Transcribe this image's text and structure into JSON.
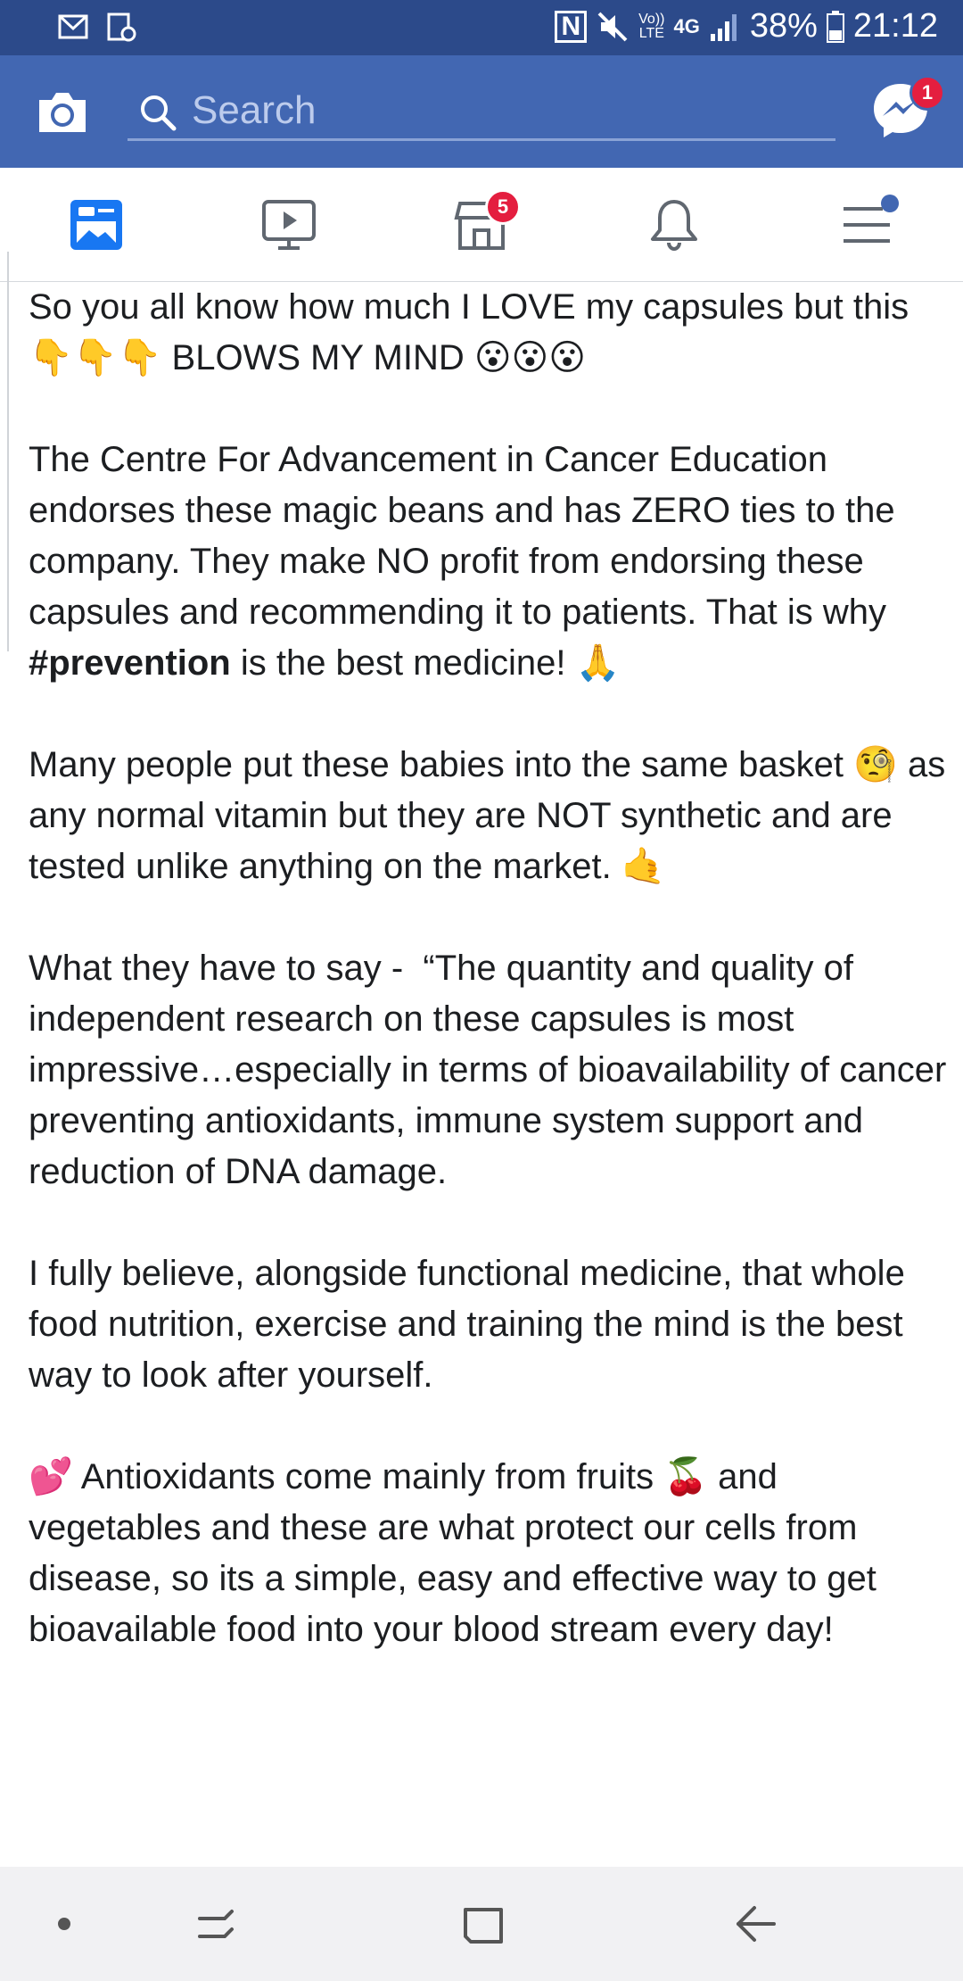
{
  "status_bar": {
    "left_icons": [
      "gmail-icon",
      "gallery-icon"
    ],
    "nfc": "N",
    "volte_top": "Vo))",
    "volte_bottom": "LTE",
    "network": "4G",
    "battery_percent": "38%",
    "time": "21:12"
  },
  "header": {
    "search_placeholder": "Search",
    "messenger_badge": "1"
  },
  "nav": {
    "marketplace_badge": "5"
  },
  "post": {
    "paragraphs": [
      "So you all know how much I LOVE my capsules but this 👇👇👇 BLOWS MY MIND 😮😮😮",
      "The Centre For Advancement in Cancer Education endorses these magic beans and has ZERO ties to the company. They make NO profit from endorsing these capsules and recommending it to patients. That is why ",
      "Many people put these babies into the same basket 🧐 as any normal vitamin but they are NOT synthetic and are tested unlike anything on the market. 🤙",
      "What they have to say -  “The quantity and quality of independent research on these capsules is most impressive…especially in terms of bioavailability of cancer preventing antioxidants, immune system support and reduction of DNA damage.",
      "I fully believe, alongside functional medicine, that whole food nutrition, exercise and training the mind is the best way to look after yourself.",
      "💕 Antioxidants come mainly from fruits 🍒 and vegetables and these are what protect our cells from disease, so its a simple, easy and effective way to get bioavailable food into your blood stream every day!"
    ],
    "hashtag": "#prevention",
    "after_hashtag": " is the best medicine! 🙏"
  }
}
